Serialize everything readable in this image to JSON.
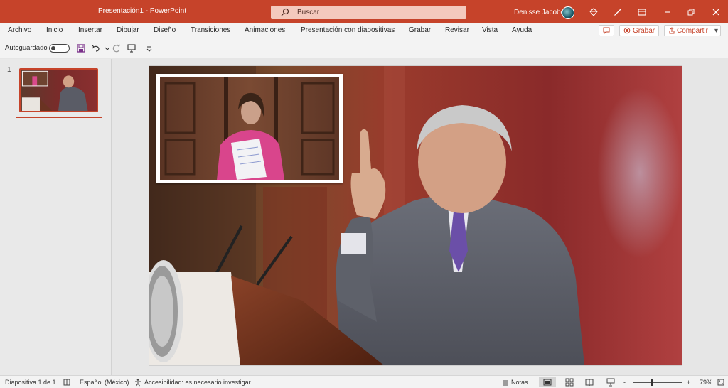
{
  "window": {
    "title": "Presentación1 - PowerPoint",
    "search_placeholder": "Buscar",
    "user_name": "Denisse Jacobo"
  },
  "ribbon": {
    "tabs": [
      "Archivo",
      "Inicio",
      "Insertar",
      "Dibujar",
      "Diseño",
      "Transiciones",
      "Animaciones",
      "Presentación con diapositivas",
      "Grabar",
      "Revisar",
      "Vista",
      "Ayuda"
    ],
    "record_label": "Grabar",
    "share_label": "Compartir"
  },
  "qat": {
    "autosave_label": "Autoguardado",
    "autosave_on": false
  },
  "thumbnails": {
    "slide_number": "1"
  },
  "statusbar": {
    "slide_info": "Diapositiva 1 de 1",
    "language": "Español (México)",
    "accessibility": "Accesibilidad: es necesario investigar",
    "notes_label": "Notas",
    "zoom": "79%",
    "zoom_minus": "-",
    "zoom_plus": "+"
  },
  "colors": {
    "accent": "#c6432a",
    "search_bg": "#f4c9bd"
  }
}
